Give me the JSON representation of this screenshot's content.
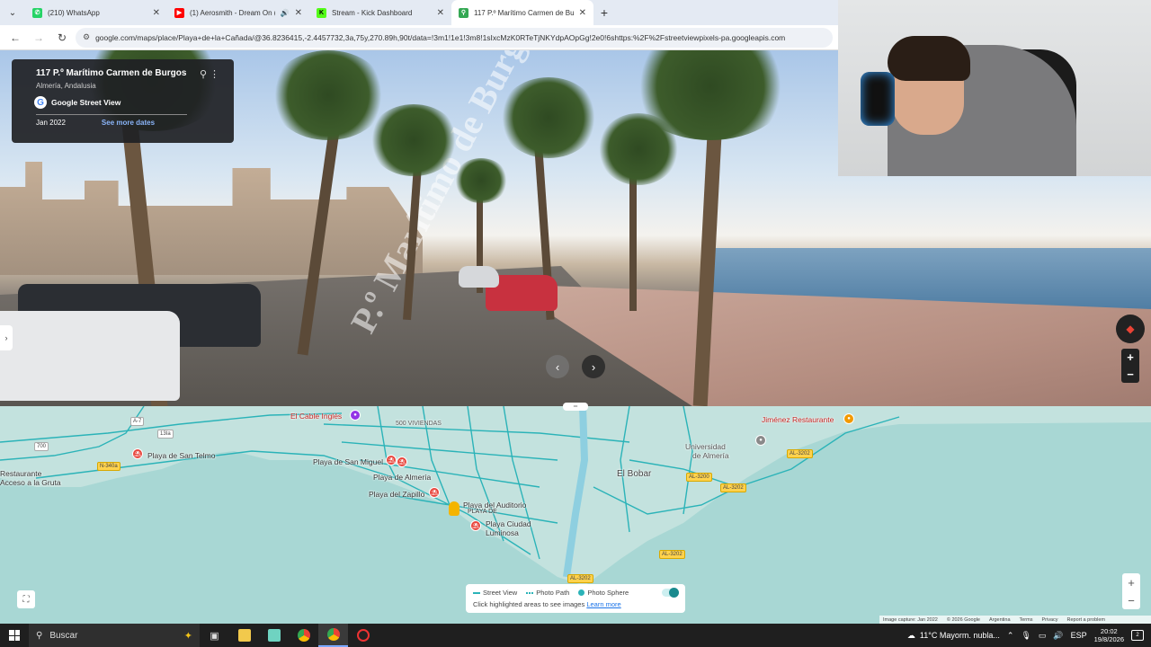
{
  "browser": {
    "tabs": [
      {
        "title": "(210) WhatsApp",
        "favicon_color": "#25d366",
        "favicon_glyph": "✆"
      },
      {
        "title": "(1) Aerosmith - Dream On (",
        "favicon_color": "#ff0000",
        "favicon_glyph": "▶",
        "audio": true
      },
      {
        "title": "Stream - Kick Dashboard",
        "favicon_color": "#53fc18",
        "favicon_glyph": "K"
      },
      {
        "title": "117 P.º Marítimo Carmen de Bu",
        "favicon_color": "#34a853",
        "favicon_glyph": "⚲",
        "active": true
      }
    ],
    "url": "google.com/maps/place/Playa+de+la+Cañada/@36.8236415,-2.4457732,3a,75y,270.89h,90t/data=!3m1!1e1!3m8!1sIxcMzK0RTeTjNKYdpAOpGg!2e0!6shttps:%2F%2Fstreetviewpixels-pa.googleapis.com",
    "icons": {
      "close": "✕",
      "new_tab": "+",
      "back": "←",
      "forward": "→",
      "reload": "↻",
      "menu": "⌄",
      "tune": "⚙",
      "speaker": "🔊"
    }
  },
  "street_view": {
    "location_title": "117 P.º Marítimo Carmen de Burgos",
    "location_subtitle": "Almería, Andalusia",
    "brand": "Google Street View",
    "capture_date": "Jan 2022",
    "see_more_dates": "See more dates",
    "road_marking": "P.º Marítimo de Burgos"
  },
  "map": {
    "labels": [
      {
        "text": "El Cable Inglés",
        "kind": "poi"
      },
      {
        "text": "500 VIVIENDAS",
        "kind": "area"
      },
      {
        "text": "Playa de San Telmo",
        "kind": "place"
      },
      {
        "text": "Playa de San Miguel",
        "kind": "place"
      },
      {
        "text": "Playa de Almería",
        "kind": "place"
      },
      {
        "text": "Playa del Zapillo",
        "kind": "place"
      },
      {
        "text": "Playa del Auditorio",
        "kind": "place"
      },
      {
        "text": "PLAYA DE",
        "kind": "area"
      },
      {
        "text": "Playa Ciudad",
        "kind": "place"
      },
      {
        "text": "Luminosa",
        "kind": "place"
      },
      {
        "text": "El Bobar",
        "kind": "big"
      },
      {
        "text": "Universidad",
        "kind": "place"
      },
      {
        "text": "de Almería",
        "kind": "place"
      },
      {
        "text": "Jiménez Restaurante",
        "kind": "poi"
      },
      {
        "text": "Restaurante",
        "kind": "place"
      },
      {
        "text": "Acceso a la Gruta",
        "kind": "place"
      }
    ],
    "road_badges": [
      "A-7",
      "700",
      "N-340a",
      "13Ia",
      "AL-3200",
      "AL-3202",
      "AL-3202",
      "AL-3202",
      "AL-3202"
    ],
    "legend": {
      "street_view": "Street View",
      "photo_path": "Photo Path",
      "photo_sphere": "Photo Sphere",
      "hint": "Click highlighted areas to see images",
      "learn_more": "Learn more"
    },
    "attribution": [
      "Image capture: Jan 2022",
      "© 2026 Google",
      "Argentina",
      "Terms",
      "Privacy",
      "Report a problem"
    ]
  },
  "taskbar": {
    "search_placeholder": "Buscar",
    "weather": "11°C  Mayorm. nubla...",
    "language": "ESP",
    "time": "20:02",
    "date": "19/8/2026",
    "notification_count": "2"
  },
  "colors": {
    "map_water": "#a8d7d4",
    "coverage": "#2bb3b8",
    "taskbar": "#1f1f1f",
    "tabstrip": "#e4eaf3"
  }
}
